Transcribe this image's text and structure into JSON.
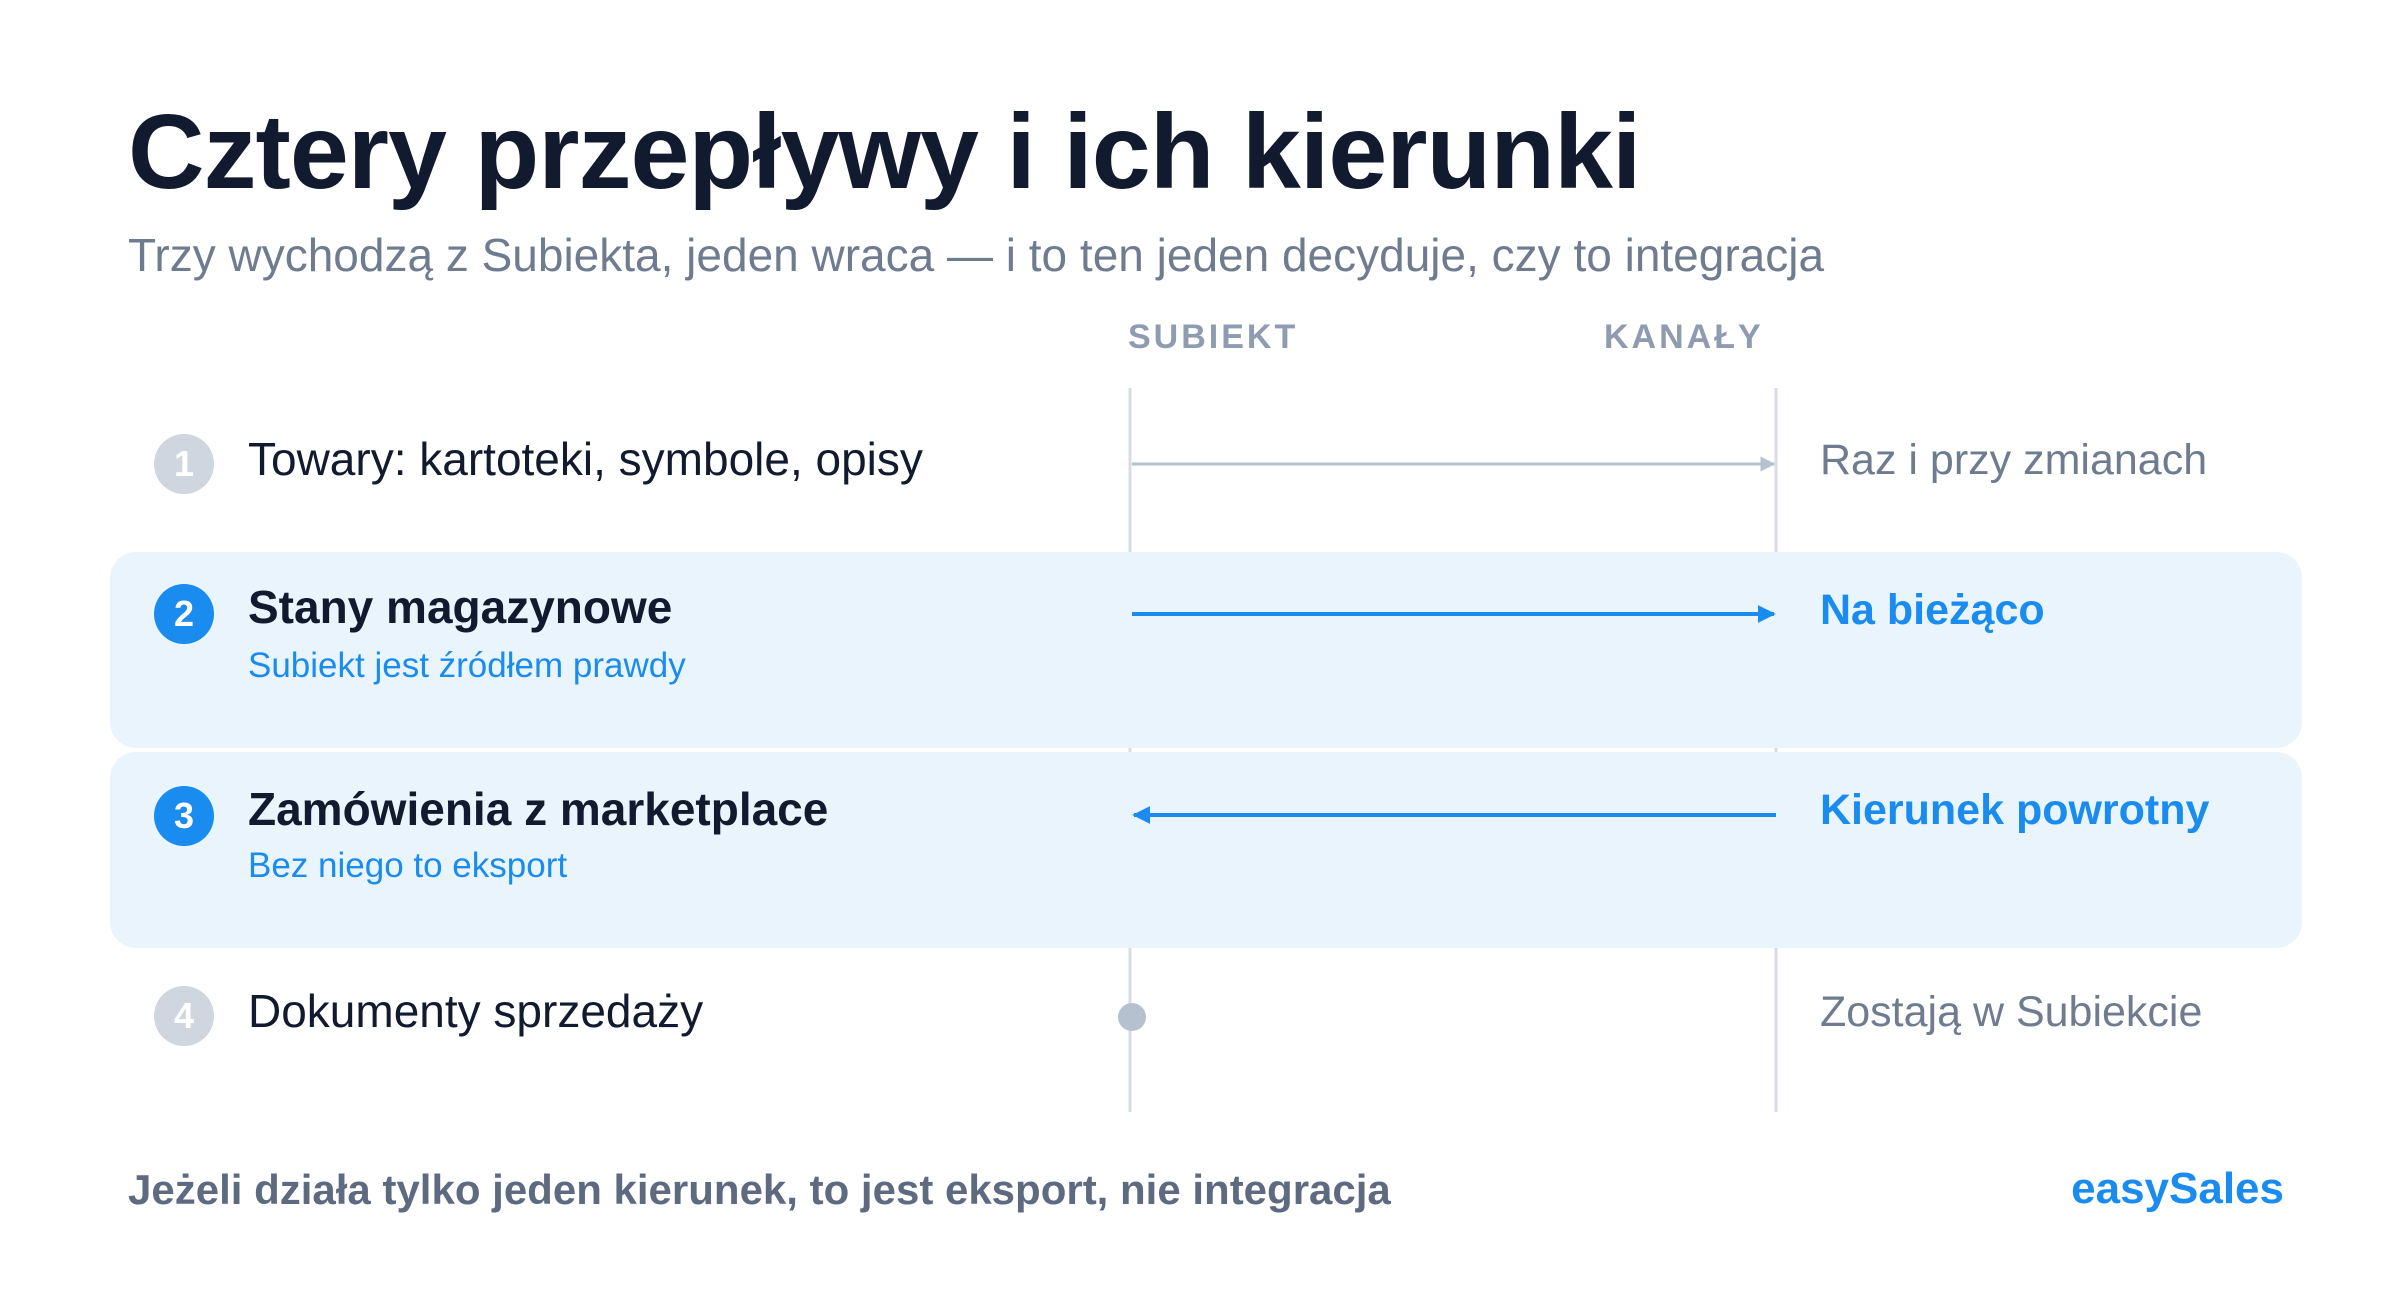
{
  "header": {
    "title": "Cztery przepływy i ich kierunki",
    "subtitle": "Trzy wychodzą z Subiekta, jeden wraca — i to ten jeden decyduje, czy to integracja"
  },
  "columns": {
    "left": "SUBIEKT",
    "right": "KANAŁY"
  },
  "flows": [
    {
      "number": "1",
      "title": "Towary: kartoteki, symbole, opisy",
      "note": "",
      "direction": "to-channels",
      "frequency": "Raz i przy zmianach",
      "highlighted": false
    },
    {
      "number": "2",
      "title": "Stany magazynowe",
      "note": "Subiekt jest źródłem prawdy",
      "direction": "to-channels",
      "frequency": "Na bieżąco",
      "highlighted": true
    },
    {
      "number": "3",
      "title": "Zamówienia z marketplace",
      "note": "Bez niego to eksport",
      "direction": "to-subiekt",
      "frequency": "Kierunek powrotny",
      "highlighted": true
    },
    {
      "number": "4",
      "title": "Dokumenty sprzedaży",
      "note": "",
      "direction": "stays",
      "frequency": "Zostają w Subiekcie",
      "highlighted": false
    }
  ],
  "footer": {
    "text": "Jeżeli działa tylko jeden kierunek, to jest eksport, nie integracja",
    "brand": "easySales"
  },
  "colors": {
    "accent": "#1a8cf0",
    "muted": "#b6c1d0",
    "band": "#eaf4fc",
    "text": "#111a2e",
    "secondary_text": "#6f7c90"
  }
}
